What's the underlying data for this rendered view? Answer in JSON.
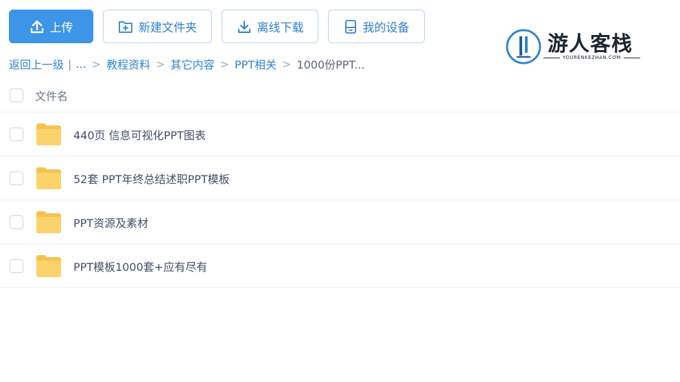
{
  "toolbar": {
    "upload_label": "上传",
    "new_folder_label": "新建文件夹",
    "offline_download_label": "离线下载",
    "my_devices_label": "我的设备"
  },
  "logo": {
    "title": "游人客栈",
    "subtitle": "YOURENKEZHAN.COM"
  },
  "breadcrumb": {
    "back": "返回上一级",
    "pipe": "|",
    "ellipsis": "...",
    "sep": ">",
    "items": [
      "教程资料",
      "其它内容",
      "PPT相关"
    ],
    "current": "1000份PPT..."
  },
  "list": {
    "header": "文件名",
    "rows": [
      {
        "name": "440页 信息可视化PPT图表",
        "icon": "folder-icon"
      },
      {
        "name": "52套 PPT年终总结述职PPT模板",
        "icon": "folder-icon"
      },
      {
        "name": "PPT资源及素材",
        "icon": "folder-icon"
      },
      {
        "name": "PPT模板1000套+应有尽有",
        "icon": "folder-icon"
      }
    ]
  },
  "colors": {
    "primary": "#3c95e7",
    "link": "#2f83d6",
    "folder": "#fcd36a",
    "text": "#424e67"
  }
}
